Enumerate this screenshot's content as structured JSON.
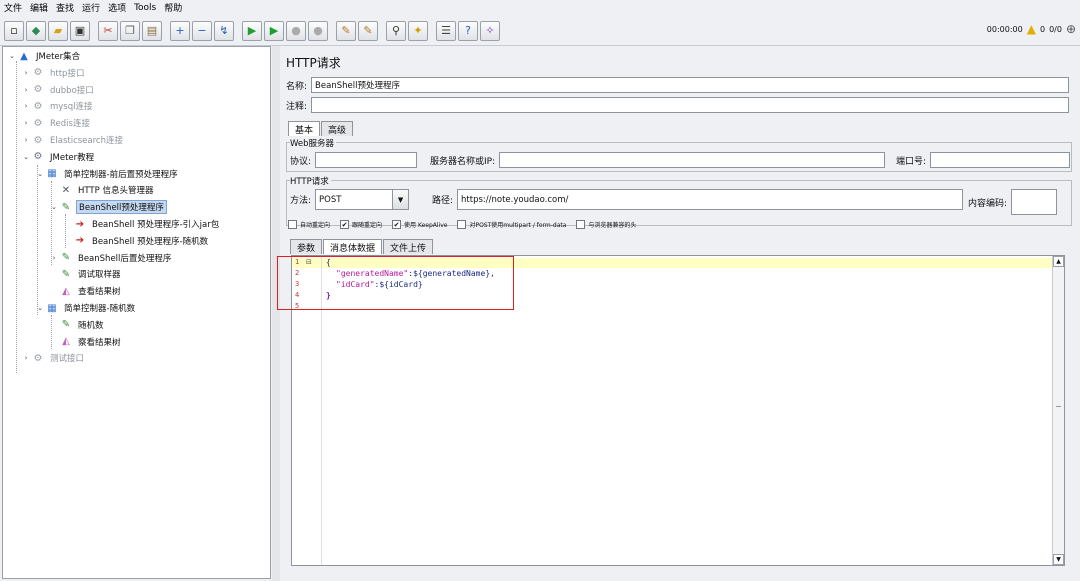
{
  "menu": [
    "文件",
    "编辑",
    "查找",
    "运行",
    "选项",
    "Tools",
    "帮助"
  ],
  "toolbar": {
    "icons": [
      "new-icon",
      "template-icon",
      "open-icon",
      "save-icon",
      "cut-icon",
      "copy-icon",
      "paste-icon",
      "expand-icon",
      "collapse-icon",
      "toggle-icon",
      "start-icon",
      "start-no-pause-icon",
      "stop-icon",
      "shutdown-icon",
      "clear-icon",
      "clear-all-icon",
      "search-icon",
      "reset-search-icon",
      "function-helper-icon",
      "help-icon",
      "remote-icon"
    ],
    "timer": "00:00:00",
    "warn_count": "0",
    "threads": "0/0"
  },
  "tree": {
    "items": [
      {
        "label": "JMeter集合",
        "icon": "testplan-icon",
        "disabled": false,
        "selected": false
      },
      {
        "label": "http接口",
        "icon": "gear-icon",
        "disabled": true,
        "selected": false
      },
      {
        "label": "dubbo接口",
        "icon": "gear-icon",
        "disabled": true,
        "selected": false
      },
      {
        "label": "mysql连接",
        "icon": "gear-icon",
        "disabled": true,
        "selected": false
      },
      {
        "label": "Redis连接",
        "icon": "gear-icon",
        "disabled": true,
        "selected": false
      },
      {
        "label": "Elasticsearch连接",
        "icon": "gear-icon",
        "disabled": true,
        "selected": false
      },
      {
        "label": "JMeter教程",
        "icon": "gear-icon",
        "disabled": false,
        "selected": false
      },
      {
        "label": "简单控制器-前后置预处理程序",
        "icon": "controller-icon",
        "disabled": false,
        "selected": false
      },
      {
        "label": "HTTP 信息头管理器",
        "icon": "tools-icon",
        "disabled": false,
        "selected": false
      },
      {
        "label": "BeanShell预处理程序",
        "icon": "pen-icon",
        "disabled": false,
        "selected": true
      },
      {
        "label": "BeanShell 预处理程序-引入jar包",
        "icon": "arrow-icon",
        "disabled": false,
        "selected": false
      },
      {
        "label": "BeanShell 预处理程序-随机数",
        "icon": "arrow-icon",
        "disabled": false,
        "selected": false
      },
      {
        "label": "BeanShell后置处理程序",
        "icon": "pen-icon",
        "disabled": false,
        "selected": false
      },
      {
        "label": "调试取样器",
        "icon": "pen-icon",
        "disabled": false,
        "selected": false
      },
      {
        "label": "查看结果树",
        "icon": "chart-icon",
        "disabled": false,
        "selected": false
      },
      {
        "label": "简单控制器-随机数",
        "icon": "controller-icon",
        "disabled": false,
        "selected": false
      },
      {
        "label": "随机数",
        "icon": "pen-icon",
        "disabled": false,
        "selected": false
      },
      {
        "label": "察看结果树",
        "icon": "chart-icon",
        "disabled": false,
        "selected": false
      },
      {
        "label": "测试接口",
        "icon": "gear-icon",
        "disabled": true,
        "selected": false
      }
    ]
  },
  "panel": {
    "title": "HTTP请求",
    "name_label": "名称:",
    "name_value": "BeanShell预处理程序",
    "comment_label": "注释:",
    "comment_value": "",
    "tabs": [
      "基本",
      "高级"
    ],
    "web_server_title": "Web服务器",
    "protocol_label": "协议:",
    "protocol_value": "",
    "server_label": "服务器名称或IP:",
    "server_value": "",
    "port_label": "端口号:",
    "port_value": "",
    "http_request_title": "HTTP请求",
    "method_label": "方法:",
    "method_value": "POST",
    "path_label": "路径:",
    "path_value": "https://note.youdao.com/",
    "encoding_label": "内容编码:",
    "encoding_value": "",
    "checkboxes": [
      {
        "label": "自动重定向",
        "checked": false
      },
      {
        "label": "跟随重定向",
        "checked": true
      },
      {
        "label": "使用 KeepAlive",
        "checked": true
      },
      {
        "label": "对POST使用multipart / form-data",
        "checked": false
      },
      {
        "label": "与浏览器兼容的头",
        "checked": false
      }
    ],
    "subtabs": [
      "参数",
      "消息体数据",
      "文件上传"
    ],
    "code_lines": [
      "1",
      "2",
      "3",
      "4",
      "5"
    ],
    "code": {
      "l1": "{",
      "l2_key": "\"generatedName\"",
      "l2_val": ":${generatedName},",
      "l3_key": "\"idCard\"",
      "l3_val": ":${idCard}",
      "l4": "}"
    }
  }
}
